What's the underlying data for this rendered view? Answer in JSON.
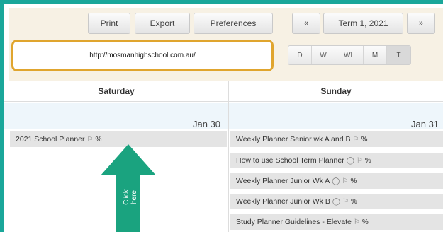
{
  "toolbar": {
    "print_label": "Print",
    "export_label": "Export",
    "preferences_label": "Preferences",
    "prev_label": "«",
    "term_label": "Term 1, 2021",
    "next_label": "»"
  },
  "url_text": "http://mosmanhighschool.com.au/",
  "view_buttons": [
    "D",
    "W",
    "WL",
    "M",
    "T"
  ],
  "active_view": "T",
  "columns": [
    {
      "day": "Saturday",
      "date": "Jan 30"
    },
    {
      "day": "Sunday",
      "date": "Jan 31"
    }
  ],
  "saturday_events": [
    {
      "title": "2021 School Planner"
    }
  ],
  "sunday_events": [
    {
      "title": "Weekly Planner Senior wk A and B"
    },
    {
      "title": "How to use School Term Planner"
    },
    {
      "title": "Weekly Planner Junior Wk A"
    },
    {
      "title": "Weekly Planner Junior Wk B"
    },
    {
      "title": "Study Planner Guidelines - Elevate"
    }
  ],
  "annotation": {
    "text": "Click here",
    "color": "#1aa37f"
  },
  "colors": {
    "frame": "#1aa79a",
    "url_border": "#e0a52e",
    "toolbar_bg": "#f7f1e4"
  }
}
